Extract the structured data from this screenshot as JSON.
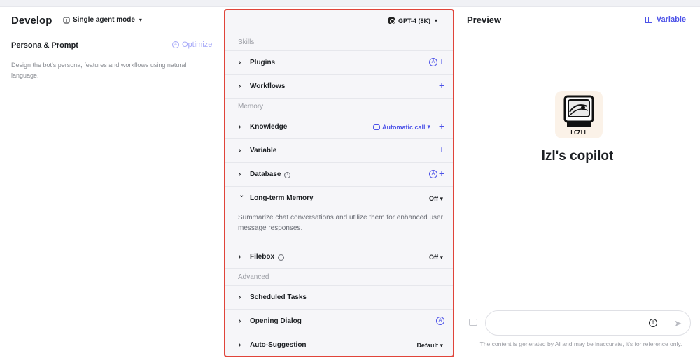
{
  "develop": {
    "title": "Develop",
    "mode_label": "Single agent mode",
    "persona_title": "Persona & Prompt",
    "optimize_label": "Optimize",
    "persona_description": "Design the bot's persona, features and workflows using natural language."
  },
  "config": {
    "model_label": "GPT-4 (8K)",
    "sections": {
      "skills": "Skills",
      "memory": "Memory",
      "advanced": "Advanced"
    },
    "rows": {
      "plugins": "Plugins",
      "workflows": "Workflows",
      "knowledge": "Knowledge",
      "knowledge_call": "Automatic call",
      "variable": "Variable",
      "database": "Database",
      "long_term_memory": "Long-term Memory",
      "long_term_memory_value": "Off",
      "long_term_memory_desc": "Summarize chat conversations and utilize them for enhanced user message responses.",
      "filebox": "Filebox",
      "filebox_value": "Off",
      "scheduled_tasks": "Scheduled Tasks",
      "opening_dialog": "Opening Dialog",
      "auto_suggestion": "Auto-Suggestion",
      "auto_suggestion_value": "Default"
    },
    "glyphs": {
      "collapsed": "›",
      "expanded": "⌄",
      "plus": "+",
      "auto": "A",
      "info": "i",
      "caret": "▾"
    }
  },
  "preview": {
    "title": "Preview",
    "variable_label": "Variable",
    "bot_name": "lzl's copilot",
    "avatar_text": "LCZLL",
    "chat_placeholder": "",
    "disclaimer": "The content is generated by AI and may be inaccurate, it's for reference only."
  },
  "colors": {
    "accent": "#4d53e8",
    "highlight_border": "#e0443a",
    "panel_bg": "#f6f6f9"
  }
}
